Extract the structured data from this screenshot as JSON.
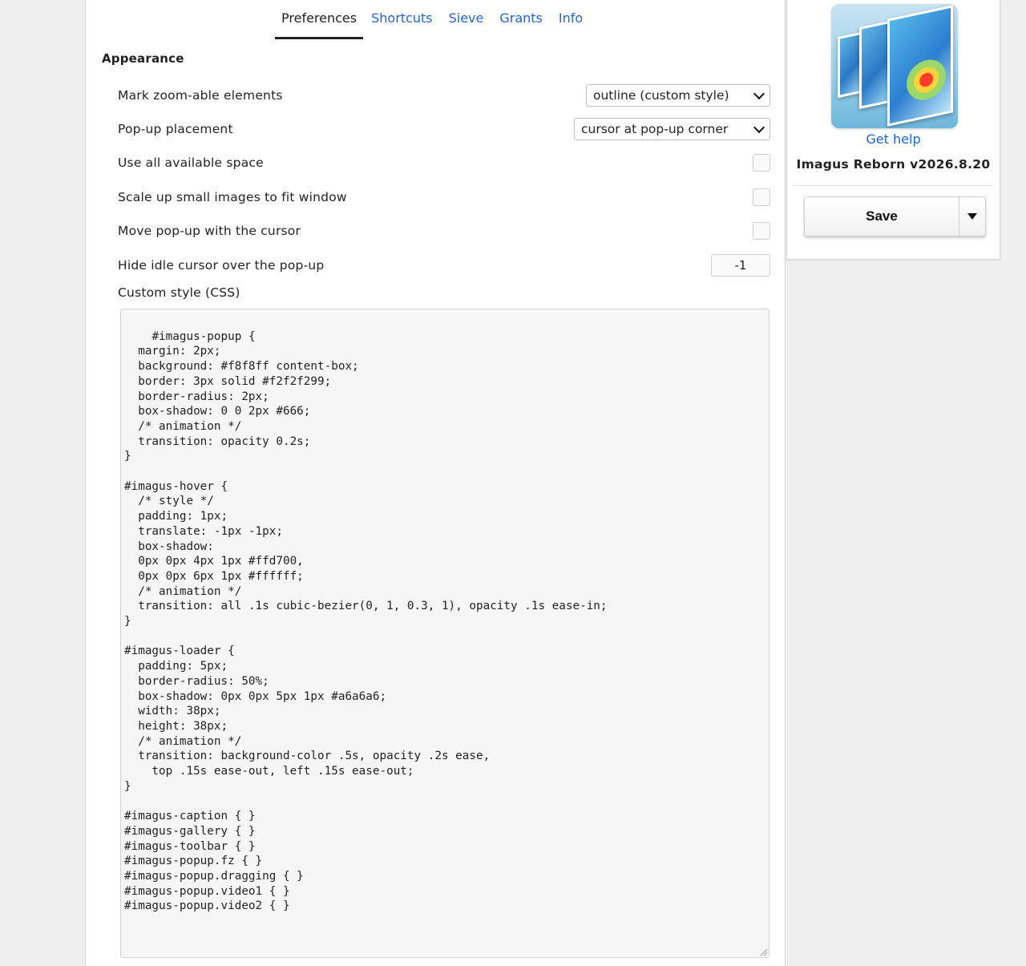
{
  "tabs": [
    {
      "label": "Preferences",
      "active": true
    },
    {
      "label": "Shortcuts",
      "active": false
    },
    {
      "label": "Sieve",
      "active": false
    },
    {
      "label": "Grants",
      "active": false
    },
    {
      "label": "Info",
      "active": false
    }
  ],
  "section_title": "Appearance",
  "settings": {
    "mark_zoomable": {
      "label": "Mark zoom-able elements",
      "value": "outline (custom style)"
    },
    "popup_placement": {
      "label": "Pop-up placement",
      "value": "cursor at pop-up corner"
    },
    "use_all_space": {
      "label": "Use all available space",
      "checked": false
    },
    "scale_up": {
      "label": "Scale up small images to fit window",
      "checked": false
    },
    "move_popup": {
      "label": "Move pop-up with the cursor",
      "checked": false
    },
    "hide_cursor": {
      "label": "Hide idle cursor over the pop-up",
      "value": "-1"
    }
  },
  "custom_css": {
    "label": "Custom style (CSS)",
    "value": "#imagus-popup {\n  margin: 2px;\n  background: #f8f8ff content-box;\n  border: 3px solid #f2f2f299;\n  border-radius: 2px;\n  box-shadow: 0 0 2px #666;\n  /* animation */\n  transition: opacity 0.2s;\n}\n\n#imagus-hover {\n  /* style */\n  padding: 1px;\n  translate: -1px -1px;\n  box-shadow:\n  0px 0px 4px 1px #ffd700,\n  0px 0px 6px 1px #ffffff;\n  /* animation */\n  transition: all .1s cubic-bezier(0, 1, 0.3, 1), opacity .1s ease-in;\n}\n\n#imagus-loader {\n  padding: 5px;\n  border-radius: 50%;\n  box-shadow: 0px 0px 5px 1px #a6a6a6;\n  width: 38px;\n  height: 38px;\n  /* animation */\n  transition: background-color .5s, opacity .2s ease,\n    top .15s ease-out, left .15s ease-out;\n}\n\n#imagus-caption { }\n#imagus-gallery { }\n#imagus-toolbar { }\n#imagus-popup.fz { }\n#imagus-popup.dragging { }\n#imagus-popup.video1 { }\n#imagus-popup.video2 { }"
  },
  "sidebar": {
    "logo_icon": "imagus-logo-icon",
    "get_help": "Get help",
    "version": "Imagus Reborn v2026.8.20",
    "save_label": "Save",
    "save_menu_icon": "triangle-down-icon"
  }
}
